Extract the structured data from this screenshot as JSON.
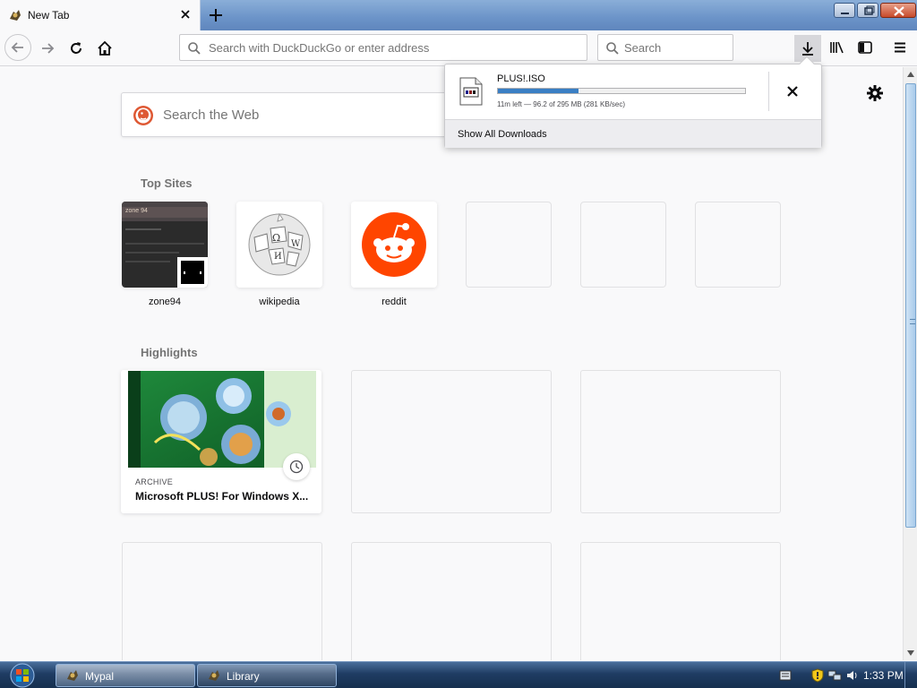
{
  "browser": {
    "tab_title": "New Tab",
    "urlbar_placeholder": "Search with DuckDuckGo or enter address",
    "searchbar_placeholder": "Search"
  },
  "newtab": {
    "web_search_placeholder": "Search the Web",
    "top_sites_title": "Top Sites",
    "top_sites": [
      {
        "label": "zone94"
      },
      {
        "label": "wikipedia"
      },
      {
        "label": "reddit"
      }
    ],
    "highlights_title": "Highlights",
    "highlight": {
      "source": "ARCHIVE",
      "title": "Microsoft PLUS! For Windows X..."
    }
  },
  "download": {
    "filename": "PLUS!.ISO",
    "status": "11m left — 96.2 of 295 MB (281 KB/sec)",
    "progress_fraction": 0.326,
    "show_all_label": "Show All Downloads"
  },
  "taskbar": {
    "items": [
      {
        "label": "Mypal"
      },
      {
        "label": "Library"
      }
    ],
    "clock": "1:33 PM"
  },
  "colors": {
    "accent": "#3a7fc4",
    "reddit": "#ff4500",
    "duckduckgo": "#de5833"
  },
  "icons": [
    "back-arrow-icon",
    "forward-arrow-icon",
    "reload-icon",
    "home-icon",
    "search-icon",
    "download-arrow-icon",
    "library-icon",
    "sidebar-icon",
    "hamburger-menu-icon",
    "gear-icon",
    "close-icon",
    "plus-icon",
    "clock-icon",
    "file-icon"
  ]
}
